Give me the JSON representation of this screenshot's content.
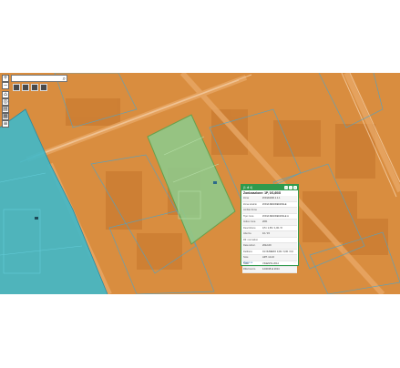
{
  "search": {
    "placeholder": "",
    "icon": "search-icon"
  },
  "controls": [
    {
      "name": "zoom-in-button",
      "glyph": "+"
    },
    {
      "name": "zoom-out-button",
      "glyph": "−"
    },
    {
      "name": "home-button",
      "glyph": "⌂"
    },
    {
      "name": "locate-button",
      "glyph": "◎"
    },
    {
      "name": "layers-button",
      "glyph": "▤"
    },
    {
      "name": "basemap-button",
      "glyph": "▦"
    },
    {
      "name": "legend-button",
      "glyph": "≡"
    }
  ],
  "popup": {
    "header": "(1 di 4)",
    "title": "Zonizzazione: 1P, 0/1,60/8",
    "rows": [
      {
        "k": "Zona",
        "v": "ZONA1000.1.1.1"
      },
      {
        "k": "Zona stralcio",
        "v": "ZONA RESIDENZIALE"
      },
      {
        "k": "Ambito Zona",
        "v": ""
      },
      {
        "k": "Tipo zona",
        "v": "ZONA RESIDENZIALE A"
      },
      {
        "k": "Indice zona",
        "v": "20%"
      },
      {
        "k": "Descrizione",
        "v": "0,5 / 1,65 / 1,00 / 8"
      },
      {
        "k": "Altezza",
        "v": "10 / 15"
      },
      {
        "k": "Rif. normativo",
        "v": ""
      },
      {
        "k": "Data istituz.",
        "v": "2012-09"
      },
      {
        "k": "Delibera",
        "v": "01 NUMERO 0,00 / 0,00 / 0,0"
      },
      {
        "k": "Note",
        "v": "ART. 14-16"
      },
      {
        "k": "Stato",
        "v": "VIGENTE 2014"
      },
      {
        "k": "Riferimento",
        "v": "12/2018 al 2014"
      }
    ],
    "footer": "Zoom a",
    "footer_right": "···"
  },
  "colors": {
    "orange": "#d98d3f",
    "cyan": "#3fb8c9",
    "green": "#8fc98a",
    "popup_green": "#2f9a4d"
  }
}
